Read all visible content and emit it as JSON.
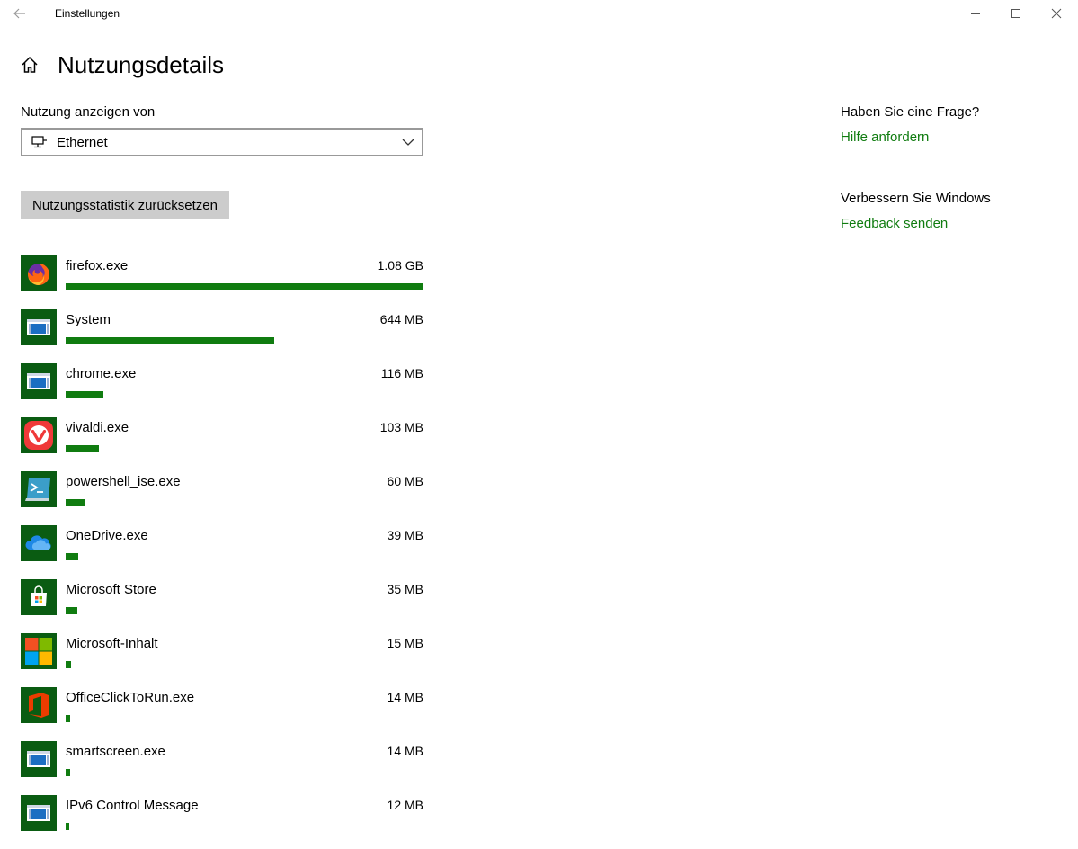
{
  "window": {
    "title": "Einstellungen"
  },
  "header": {
    "title": "Nutzungsdetails"
  },
  "usage": {
    "show_label": "Nutzung anzeigen von",
    "selected_network": "Ethernet",
    "reset_label": "Nutzungsstatistik zurücksetzen"
  },
  "apps": [
    {
      "name": "firefox.exe",
      "size": "1.08 GB",
      "fraction": 1.0,
      "icon": "firefox-icon"
    },
    {
      "name": "System",
      "size": "644 MB",
      "fraction": 0.582,
      "icon": "system-app-icon"
    },
    {
      "name": "chrome.exe",
      "size": "116 MB",
      "fraction": 0.105,
      "icon": "system-app-icon"
    },
    {
      "name": "vivaldi.exe",
      "size": "103 MB",
      "fraction": 0.093,
      "icon": "vivaldi-icon"
    },
    {
      "name": "powershell_ise.exe",
      "size": "60 MB",
      "fraction": 0.054,
      "icon": "powershell-icon"
    },
    {
      "name": "OneDrive.exe",
      "size": "39 MB",
      "fraction": 0.035,
      "icon": "onedrive-icon"
    },
    {
      "name": "Microsoft Store",
      "size": "35 MB",
      "fraction": 0.032,
      "icon": "store-icon"
    },
    {
      "name": "Microsoft-Inhalt",
      "size": "15 MB",
      "fraction": 0.014,
      "icon": "microsoft-logo-icon"
    },
    {
      "name": "OfficeClickToRun.exe",
      "size": "14 MB",
      "fraction": 0.013,
      "icon": "office-icon"
    },
    {
      "name": "smartscreen.exe",
      "size": "14 MB",
      "fraction": 0.013,
      "icon": "system-app-icon"
    },
    {
      "name": "IPv6 Control Message",
      "size": "12 MB",
      "fraction": 0.011,
      "icon": "system-app-icon"
    }
  ],
  "sidebar": {
    "question": "Haben Sie eine Frage?",
    "help_link": "Hilfe anfordern",
    "improve": "Verbessern Sie Windows",
    "feedback_link": "Feedback senden"
  },
  "colors": {
    "accent": "#107c10",
    "icon_tile": "#0a5c12",
    "button_bg": "#cccccc"
  }
}
